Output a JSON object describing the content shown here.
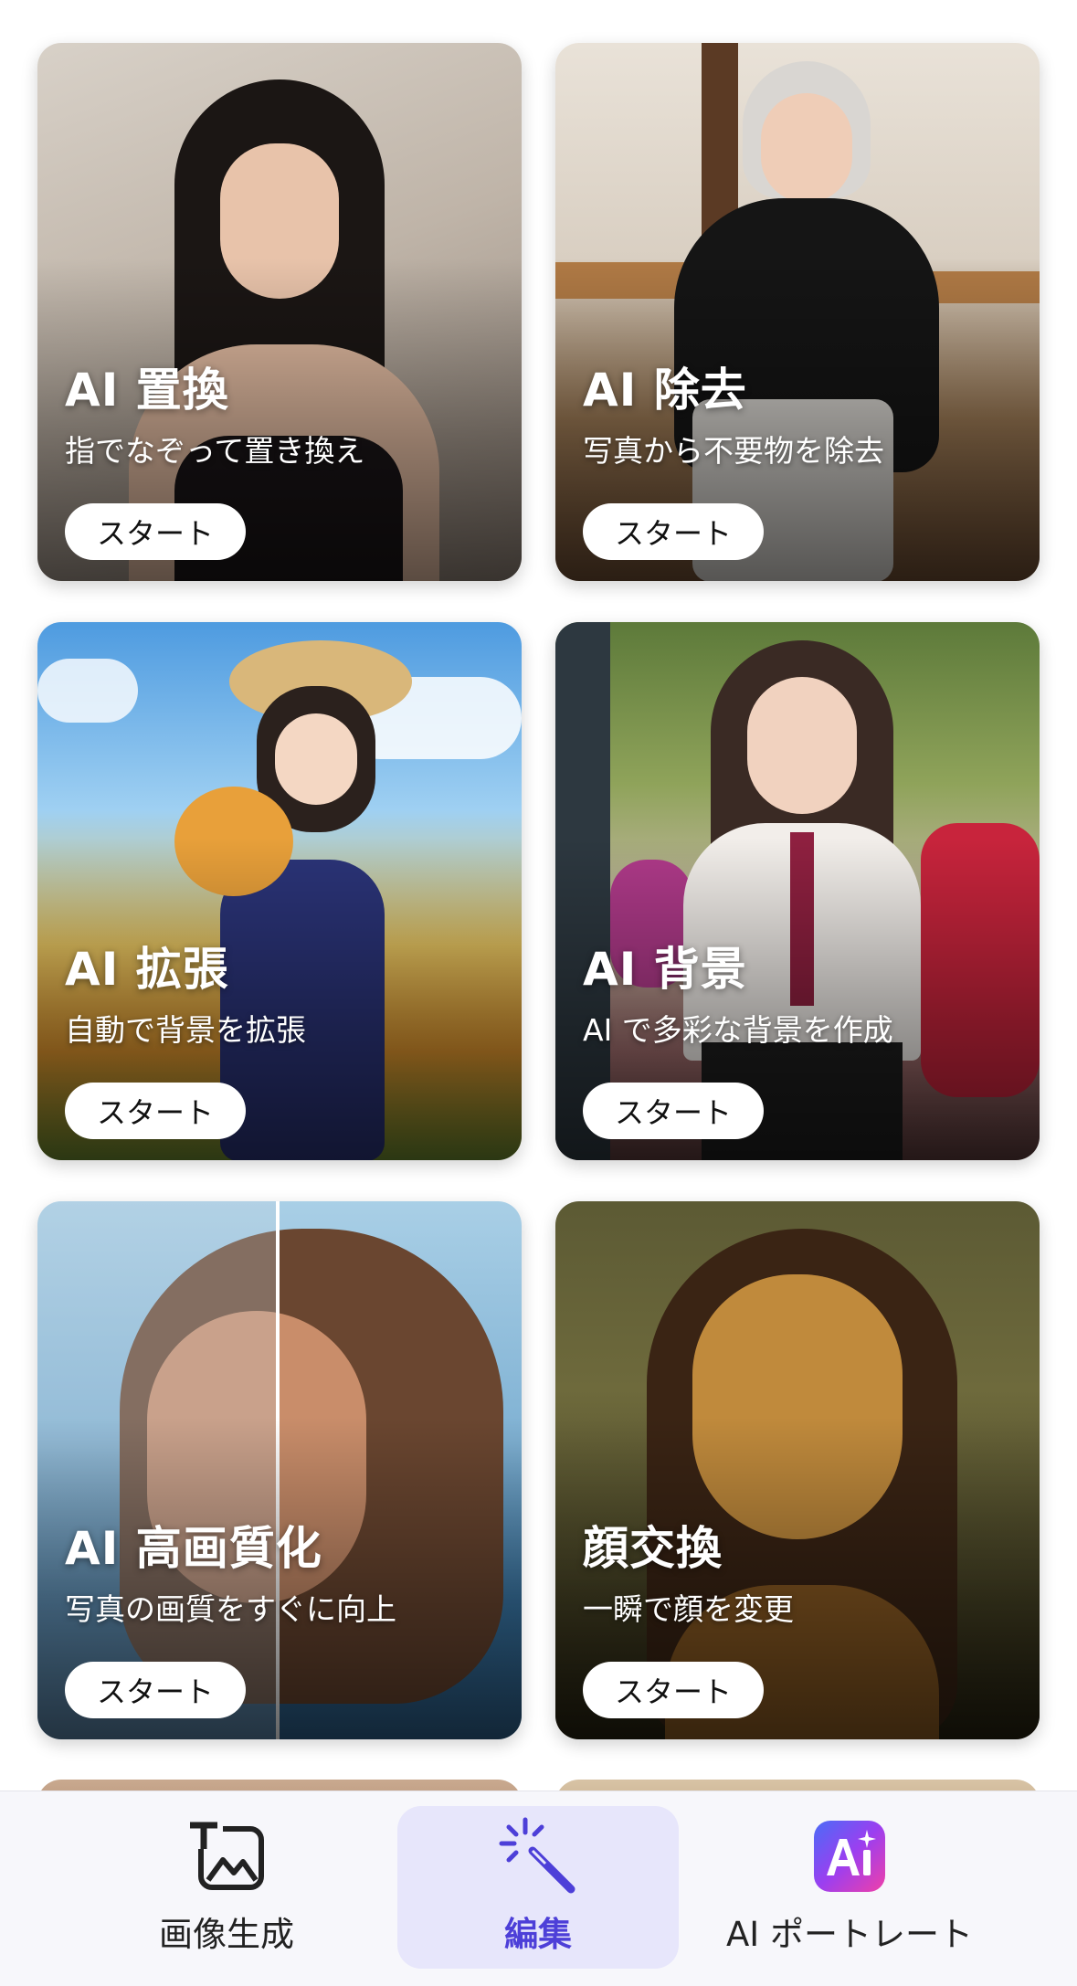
{
  "cards": [
    {
      "title": "AI 置換",
      "subtitle": "指でなぞって置き換え",
      "button": "スタート"
    },
    {
      "title": "AI 除去",
      "subtitle": "写真から不要物を除去",
      "button": "スタート"
    },
    {
      "title": "AI 拡張",
      "subtitle": "自動で背景を拡張",
      "button": "スタート"
    },
    {
      "title": "AI 背景",
      "subtitle": "AI で多彩な背景を作成",
      "button": "スタート"
    },
    {
      "title": "AI 高画質化",
      "subtitle": "写真の画質をすぐに向上",
      "button": "スタート"
    },
    {
      "title": "顔交換",
      "subtitle": "一瞬で顔を変更",
      "button": "スタート"
    }
  ],
  "nav": {
    "items": [
      {
        "label": "画像生成",
        "icon": "text-to-image-icon",
        "active": false
      },
      {
        "label": "編集",
        "icon": "magic-wand-icon",
        "active": true
      },
      {
        "label": "AI ポートレート",
        "icon": "ai-portrait-icon",
        "active": false
      }
    ]
  },
  "colors": {
    "accent": "#4d3fd8",
    "active_bg": "#e7e6fb"
  }
}
